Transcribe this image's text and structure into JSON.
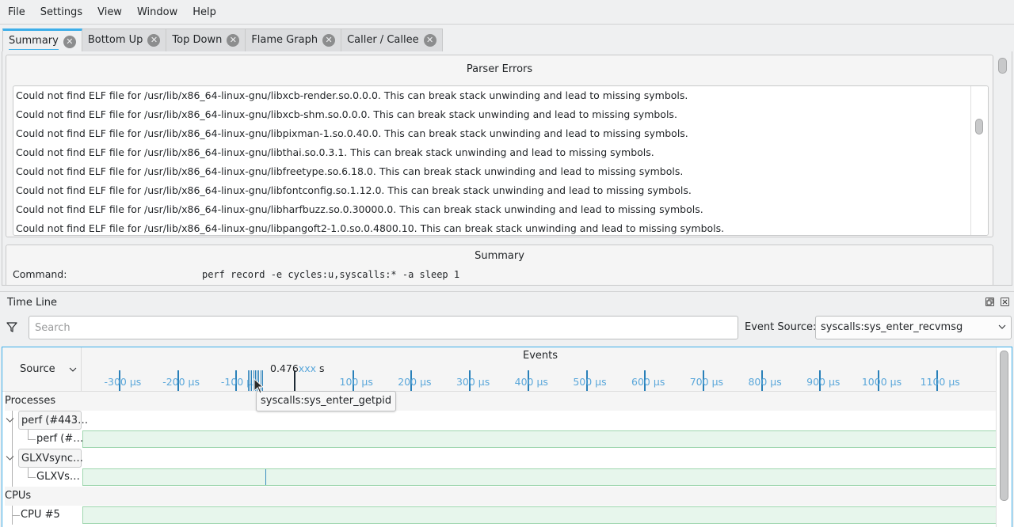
{
  "menu": [
    "File",
    "Settings",
    "View",
    "Window",
    "Help"
  ],
  "tabs": [
    {
      "label": "Summary",
      "active": true
    },
    {
      "label": "Bottom Up",
      "active": false
    },
    {
      "label": "Top Down",
      "active": false
    },
    {
      "label": "Flame Graph",
      "active": false
    },
    {
      "label": "Caller / Callee",
      "active": false
    }
  ],
  "parser_errors": {
    "title": "Parser Errors",
    "rows": [
      "Could not find ELF file for /usr/lib/x86_64-linux-gnu/libxcb-render.so.0.0.0. This can break stack unwinding and lead to missing symbols.",
      "Could not find ELF file for /usr/lib/x86_64-linux-gnu/libxcb-shm.so.0.0.0. This can break stack unwinding and lead to missing symbols.",
      "Could not find ELF file for /usr/lib/x86_64-linux-gnu/libpixman-1.so.0.40.0. This can break stack unwinding and lead to missing symbols.",
      "Could not find ELF file for /usr/lib/x86_64-linux-gnu/libthai.so.0.3.1. This can break stack unwinding and lead to missing symbols.",
      "Could not find ELF file for /usr/lib/x86_64-linux-gnu/libfreetype.so.6.18.0. This can break stack unwinding and lead to missing symbols.",
      "Could not find ELF file for /usr/lib/x86_64-linux-gnu/libfontconfig.so.1.12.0. This can break stack unwinding and lead to missing symbols.",
      "Could not find ELF file for /usr/lib/x86_64-linux-gnu/libharfbuzz.so.0.30000.0. This can break stack unwinding and lead to missing symbols.",
      "Could not find ELF file for /usr/lib/x86_64-linux-gnu/libpangoft2-1.0.so.0.4800.10. This can break stack unwinding and lead to missing symbols."
    ]
  },
  "summary": {
    "title": "Summary",
    "command_label": "Command:",
    "command_value": "perf record -e cycles:u,syscalls:* -a sleep 1"
  },
  "timeline": {
    "title": "Time Line",
    "search_placeholder": "Search",
    "search_value": "",
    "event_source_label": "Event Source:",
    "event_source_value": "syscalls:sys_enter_recvmsg",
    "source_header": "Source",
    "events_header": "Events",
    "cursor_time_prefix": "0.476",
    "cursor_time_mask": "xxx",
    "cursor_time_unit": "s",
    "ticks_us": [
      -300,
      -200,
      -100,
      100,
      200,
      300,
      400,
      500,
      600,
      700,
      800,
      900,
      1000,
      1100
    ],
    "tick_unit": "µs",
    "tooltip": "syscalls:sys_enter_getpid",
    "rows": [
      {
        "type": "section",
        "label": "Processes"
      },
      {
        "type": "group",
        "label": "perf (#443…",
        "expanded": true
      },
      {
        "type": "leaf",
        "label": "perf (#…",
        "bar": true
      },
      {
        "type": "group",
        "label": "GLXVsync…",
        "expanded": true
      },
      {
        "type": "leaf",
        "label": "GLXVs…",
        "bar": true,
        "event_at_us": -50
      },
      {
        "type": "section",
        "label": "CPUs"
      },
      {
        "type": "cpu",
        "label": "CPU #5",
        "bar": true
      }
    ]
  },
  "colors": {
    "accent": "#3daee9",
    "tick": "#2980b9",
    "tick_label": "#5aa7da",
    "bar_fill": "#e7f6ec",
    "bar_border": "#9ed6ae"
  }
}
